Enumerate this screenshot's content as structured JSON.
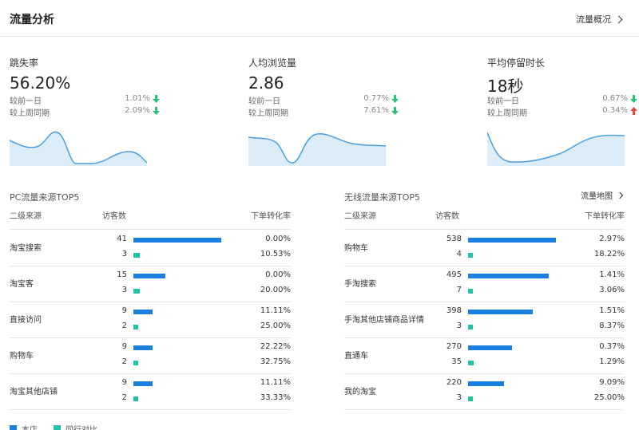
{
  "header": {
    "title": "流量分析",
    "overview_link": "流量概况"
  },
  "metrics": [
    {
      "label": "跳失率",
      "value": "56.20%",
      "comparisons": [
        {
          "label": "较前一日",
          "value": "1.01%",
          "trend": "down"
        },
        {
          "label": "较上周同期",
          "value": "2.09%",
          "trend": "down"
        }
      ]
    },
    {
      "label": "人均浏览量",
      "value": "2.86",
      "comparisons": [
        {
          "label": "较前一日",
          "value": "0.77%",
          "trend": "down"
        },
        {
          "label": "较上周同期",
          "value": "7.61%",
          "trend": "down"
        }
      ]
    },
    {
      "label": "平均停留时长",
      "value": "18秒",
      "comparisons": [
        {
          "label": "较前一日",
          "value": "0.67%",
          "trend": "down"
        },
        {
          "label": "较上周同期",
          "value": "0.34%",
          "trend": "up"
        }
      ]
    }
  ],
  "colors": {
    "down": "#2bbf7e",
    "up": "#e8454b",
    "store": "#1a7fde",
    "peer": "#20c3a6",
    "spark": "#4a9fe0",
    "spark_fill": "#dcecf9"
  },
  "pc_table": {
    "title": "PC流量来源TOP5",
    "columns": {
      "source": "二级来源",
      "visitors": "访客数",
      "conversion": "下单转化率"
    },
    "rows": [
      {
        "name": "淘宝搜索",
        "store_visitors": 41,
        "peer_visitors": 3,
        "store_rate": "0.00%",
        "peer_rate": "10.53%"
      },
      {
        "name": "淘宝客",
        "store_visitors": 15,
        "peer_visitors": 3,
        "store_rate": "0.00%",
        "peer_rate": "20.00%"
      },
      {
        "name": "直接访问",
        "store_visitors": 9,
        "peer_visitors": 2,
        "store_rate": "11.11%",
        "peer_rate": "25.00%"
      },
      {
        "name": "购物车",
        "store_visitors": 9,
        "peer_visitors": 2,
        "store_rate": "22.22%",
        "peer_rate": "32.75%"
      },
      {
        "name": "淘宝其他店铺",
        "store_visitors": 9,
        "peer_visitors": 2,
        "store_rate": "11.11%",
        "peer_rate": "33.33%"
      }
    ]
  },
  "wireless_table": {
    "title": "无线流量来源TOP5",
    "map_link": "流量地图",
    "columns": {
      "source": "二级来源",
      "visitors": "访客数",
      "conversion": "下单转化率"
    },
    "rows": [
      {
        "name": "购物车",
        "store_visitors": 538,
        "peer_visitors": 4,
        "store_rate": "2.97%",
        "peer_rate": "18.22%"
      },
      {
        "name": "手淘搜索",
        "store_visitors": 495,
        "peer_visitors": 7,
        "store_rate": "1.41%",
        "peer_rate": "3.06%"
      },
      {
        "name": "手淘其他店铺商品详情",
        "store_visitors": 398,
        "peer_visitors": 3,
        "store_rate": "1.51%",
        "peer_rate": "8.37%"
      },
      {
        "name": "直通车",
        "store_visitors": 270,
        "peer_visitors": 35,
        "store_rate": "0.37%",
        "peer_rate": "1.29%"
      },
      {
        "name": "我的淘宝",
        "store_visitors": 220,
        "peer_visitors": 3,
        "store_rate": "9.09%",
        "peer_rate": "25.00%"
      }
    ]
  },
  "legend": {
    "store": "本店",
    "peer": "同行对比"
  }
}
